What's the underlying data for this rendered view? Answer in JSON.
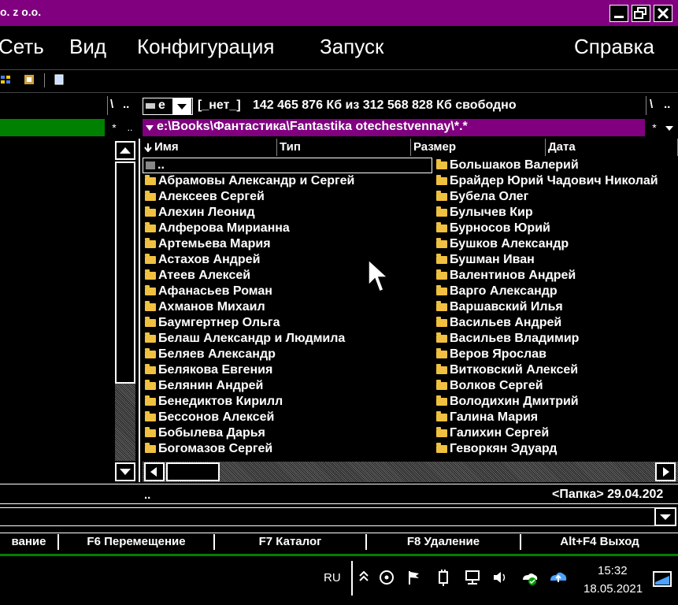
{
  "window": {
    "title": "o. z o.o."
  },
  "menu": [
    "Сеть",
    "Вид",
    "Конфигурация",
    "Запуск",
    "Справка"
  ],
  "left_panel": {
    "path_sep": "\\",
    "up": ".."
  },
  "drive_bar": {
    "drive": "e",
    "volume_label": "[_нет_]",
    "free_text": "142 465 876 Кб из 312 568 828 Кб свободно",
    "root": "\\",
    "up": ".."
  },
  "path": {
    "text": "e:\\Books\\Фантастика\\Fantastika otechestvennay\\*.*",
    "star": "*"
  },
  "columns": [
    "Имя",
    "Тип",
    "Размер",
    "Дата"
  ],
  "files_col1": [
    "..",
    "Абрамовы Александр и Сергей",
    "Алексеев Сергей",
    "Алехин Леонид",
    "Алферова Мирианна",
    "Артемьева Мария",
    "Астахов Андрей",
    "Атеев Алексей",
    "Афанасьев Роман",
    "Ахманов Михаил",
    "Баумгертнер Ольга",
    "Белаш Александр и Людмила",
    "Беляев Александр",
    "Белякова Евгения",
    "Белянин Андрей",
    "Бенедиктов Кирилл",
    "Бессонов Алексей",
    "Бобылева Дарья",
    "Богомазов Сергей"
  ],
  "files_col2": [
    "Большаков Валерий",
    "Брайдер Юрий Чадович Николай",
    "Бубела Олег",
    "Булычев Кир",
    "Бурносов Юрий",
    "Бушков Александр",
    "Бушман Иван",
    "Валентинов Андрей",
    "Варго Александр",
    "Варшавский Илья",
    "Васильев Андрей",
    "Васильев Владимир",
    "Веров Ярослав",
    "Витковский Алексей",
    "Волков Сергей",
    "Володихин Дмитрий",
    "Галина Мария",
    "Галихин Сергей",
    "Геворкян Эдуард"
  ],
  "status": {
    "left": "..",
    "right": "<Папка> 29.04.202"
  },
  "fkeys": [
    "вание",
    "F6 Перемещение",
    "F7 Каталог",
    "F8 Удаление",
    "Alt+F4 Выход"
  ],
  "taskbar": {
    "lang": "RU",
    "time": "15:32",
    "date": "18.05.2021"
  },
  "colors": {
    "accent": "#800080",
    "green": "#008000",
    "folder": "#f0c040"
  }
}
